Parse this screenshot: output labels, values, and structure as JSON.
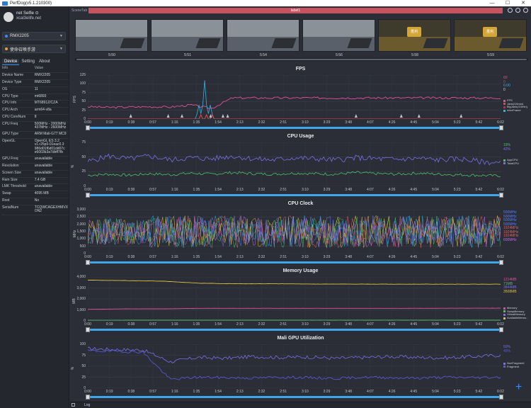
{
  "window": {
    "title": "PerfDog(v5.1.210300)",
    "controls": [
      "—",
      "☐",
      "✕"
    ]
  },
  "user": {
    "name": "net Selfie ⊙",
    "email": "xcal3elife.net"
  },
  "device_select": {
    "value": "RMX2205"
  },
  "app_select": {
    "value": "使命召唤手游"
  },
  "tabs": [
    "Device",
    "Setting",
    "About"
  ],
  "info_table": {
    "headers": [
      "Info",
      "Value"
    ],
    "rows": [
      [
        "Device Name",
        "RMX2205"
      ],
      [
        "Device Type",
        "RMX2205"
      ],
      [
        "OS",
        "11"
      ],
      [
        "CPU Type",
        "mt6893"
      ],
      [
        "CPU Info",
        "MT6891Z/CZA"
      ],
      [
        "CPU Arch",
        "arm64-v8a"
      ],
      [
        "CPU CoreNum",
        "8"
      ],
      [
        "CPU Freq",
        "500MHz - 2000MHz\n437MHz - 2600MHz"
      ],
      [
        "GPU Type",
        "ARM Mali-G77 MC9"
      ],
      [
        "OpenGL",
        "OpenGL ES 3.2\nv1.r25p0-01eac0.3\n986d01f6d01dd07c\ne6003b3a7dbff7fb"
      ],
      [
        "GPU Freq",
        "unavailable"
      ],
      [
        "Resolution",
        "unavailable"
      ],
      [
        "Screen Size",
        "unavailable"
      ],
      [
        "Ram Size",
        "7.4 GB"
      ],
      [
        "LMK Threshold",
        "unavailable"
      ],
      [
        "Swap",
        "4095 MB"
      ],
      [
        "Root",
        "No"
      ],
      [
        "SerialNum",
        "TCQWCAGEXHMVX\nON2"
      ]
    ]
  },
  "scene": {
    "label": "SceneTab",
    "tag": "label1"
  },
  "thumbnails": {
    "times": [
      "5:50",
      "5:51",
      "5:54",
      "5:56",
      "5:58",
      "5:59"
    ],
    "badges": [
      "胜利",
      "胜利"
    ]
  },
  "x_ticks": [
    "0:00",
    "0:19",
    "0:38",
    "0:57",
    "1:16",
    "1:35",
    "1:54",
    "2:13",
    "2:32",
    "2:51",
    "3:10",
    "3:29",
    "3:48",
    "4:07",
    "4:26",
    "4:45",
    "5:04",
    "5:23",
    "5:42",
    "6:02"
  ],
  "charts": {
    "fps": {
      "title": "FPS",
      "ylabel": "FPS",
      "yticks": [
        "125",
        "100",
        "75",
        "50",
        "25",
        "0"
      ],
      "legend_values": [
        {
          "text": "60",
          "color": "#e0509a"
        },
        {
          "text": "0",
          "color": "#e04a4a"
        },
        {
          "text": "0.00",
          "color": "#2fb3e6"
        },
        {
          "text": "0",
          "color": "#d8d8d8"
        }
      ],
      "legend_items": [
        {
          "text": "FPS",
          "color": "#e0509a"
        },
        {
          "text": "Jank(/10min)",
          "color": "#e04a4a"
        },
        {
          "text": "BigJank(/10min)",
          "color": "#c03030"
        },
        {
          "text": "InterFrame",
          "color": "#2fb3e6"
        }
      ]
    },
    "cpu_usage": {
      "title": "CPU Usage",
      "ylabel": "%",
      "yticks": [
        "75",
        "50",
        "25",
        "0"
      ],
      "legend_values": [
        {
          "text": "19%",
          "color": "#4fbf6a"
        },
        {
          "text": "42%",
          "color": "#7b6ee6"
        }
      ],
      "legend_items": [
        {
          "text": "AppCPU",
          "color": "#4fbf6a"
        },
        {
          "text": "TotalCPU",
          "color": "#7b6ee6"
        }
      ]
    },
    "cpu_clock": {
      "title": "CPU Clock",
      "ylabel": "MHz",
      "yticks": [
        "3,000",
        "2,500",
        "2,000",
        "1,500",
        "1,000",
        "500",
        "0"
      ],
      "legend_values": [
        {
          "text": "500MHz",
          "color": "#5f7de8"
        },
        {
          "text": "500MHz",
          "color": "#5f7de8"
        },
        {
          "text": "500MHz",
          "color": "#5f7de8"
        },
        {
          "text": "500MHz",
          "color": "#5f7de8"
        },
        {
          "text": "1924MHz",
          "color": "#e06060"
        },
        {
          "text": "1924MHz",
          "color": "#e06060"
        },
        {
          "text": "1924MHz",
          "color": "#e06060"
        },
        {
          "text": "600MHz",
          "color": "#c070e0"
        }
      ]
    },
    "memory": {
      "title": "Memory Usage",
      "ylabel": "MB",
      "yticks": [
        "4,000",
        "3,000",
        "2,000",
        "1,000",
        "0"
      ],
      "legend_values": [
        {
          "text": "1214MB",
          "color": "#e0509a"
        },
        {
          "text": "71MB",
          "color": "#4fbf6a"
        },
        {
          "text": "3844MB",
          "color": "#7b6ee6"
        },
        {
          "text": "3508MB",
          "color": "#e0c040"
        }
      ],
      "legend_items": [
        {
          "text": "Memory",
          "color": "#e0509a"
        },
        {
          "text": "SwapMemory",
          "color": "#4fbf6a"
        },
        {
          "text": "VirtualMemory",
          "color": "#7b6ee6"
        },
        {
          "text": "AvailableMemo..",
          "color": "#e0c040"
        }
      ]
    },
    "gpu": {
      "title": "Mali GPU Utilization",
      "ylabel": "%",
      "yticks": [
        "100",
        "75",
        "50",
        "25",
        "0"
      ],
      "legend_values": [
        {
          "text": "50%",
          "color": "#7b6ee6"
        },
        {
          "text": "49%",
          "color": "#5a5ae0"
        }
      ],
      "legend_items": [
        {
          "text": "NonFragment",
          "color": "#7b6ee6"
        },
        {
          "text": "Fragment",
          "color": "#5a5ae0"
        }
      ]
    }
  },
  "chart_data": [
    {
      "type": "line",
      "title": "FPS",
      "ylabel": "FPS",
      "ylim": [
        0,
        125
      ],
      "x_range": [
        "0:00",
        "6:02"
      ],
      "series": [
        {
          "name": "FPS",
          "approx": [
            35,
            33,
            34,
            35,
            34,
            40,
            30,
            60,
            60,
            60,
            60,
            60,
            60,
            60,
            60,
            60,
            60,
            60,
            60,
            60,
            60
          ]
        },
        {
          "name": "InterFrame",
          "approx": [
            0,
            0,
            0,
            0,
            0,
            0,
            110,
            0,
            0,
            0,
            0,
            0,
            0,
            0,
            0,
            0,
            0,
            0,
            0,
            0,
            0
          ]
        }
      ]
    },
    {
      "type": "line",
      "title": "CPU Usage",
      "ylabel": "%",
      "ylim": [
        0,
        80
      ],
      "series": [
        {
          "name": "AppCPU",
          "approx": [
            20,
            22,
            20,
            23,
            21,
            24,
            22,
            25,
            23,
            22,
            24,
            23,
            22,
            25,
            23,
            22,
            24,
            22,
            21,
            20,
            19
          ]
        },
        {
          "name": "TotalCPU",
          "approx": [
            45,
            55,
            50,
            55,
            48,
            52,
            50,
            55,
            50,
            48,
            52,
            50,
            48,
            52,
            50,
            49,
            51,
            48,
            50,
            45,
            42
          ]
        }
      ]
    },
    {
      "type": "line",
      "title": "CPU Clock",
      "ylabel": "MHz",
      "ylim": [
        0,
        3000
      ]
    },
    {
      "type": "line",
      "title": "Memory Usage",
      "ylabel": "MB",
      "ylim": [
        0,
        4200
      ],
      "series": [
        {
          "name": "Memory",
          "approx": [
            1100,
            1150,
            1150,
            1200,
            1200,
            1200,
            1200,
            1200,
            1200,
            1200,
            1210,
            1214
          ]
        },
        {
          "name": "SwapMemory",
          "approx": [
            60,
            65,
            70,
            70,
            70,
            70,
            71,
            71,
            71,
            71,
            71,
            71
          ]
        },
        {
          "name": "AvailableMemo..",
          "approx": [
            3900,
            3850,
            3800,
            3600,
            3550,
            3550,
            3520,
            3520,
            3510,
            3510,
            3508,
            3508
          ]
        }
      ]
    },
    {
      "type": "line",
      "title": "Mali GPU Utilization",
      "ylabel": "%",
      "ylim": [
        0,
        100
      ],
      "series": [
        {
          "name": "NonFragment",
          "approx": [
            90,
            88,
            87,
            60,
            70,
            68,
            72,
            70,
            71,
            68,
            70,
            72,
            70,
            69,
            72,
            75
          ]
        },
        {
          "name": "Fragment",
          "approx": [
            85,
            84,
            82,
            20,
            25,
            24,
            23,
            25,
            24,
            22,
            25,
            24,
            23,
            25,
            24,
            25
          ]
        }
      ]
    }
  ]
}
